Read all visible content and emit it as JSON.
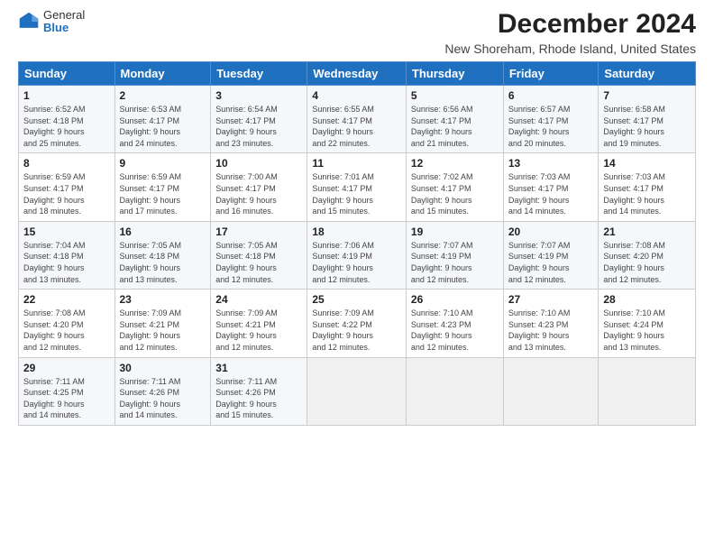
{
  "logo": {
    "general": "General",
    "blue": "Blue"
  },
  "title": "December 2024",
  "subtitle": "New Shoreham, Rhode Island, United States",
  "days_of_week": [
    "Sunday",
    "Monday",
    "Tuesday",
    "Wednesday",
    "Thursday",
    "Friday",
    "Saturday"
  ],
  "weeks": [
    [
      {
        "day": "1",
        "info": "Sunrise: 6:52 AM\nSunset: 4:18 PM\nDaylight: 9 hours\nand 25 minutes."
      },
      {
        "day": "2",
        "info": "Sunrise: 6:53 AM\nSunset: 4:17 PM\nDaylight: 9 hours\nand 24 minutes."
      },
      {
        "day": "3",
        "info": "Sunrise: 6:54 AM\nSunset: 4:17 PM\nDaylight: 9 hours\nand 23 minutes."
      },
      {
        "day": "4",
        "info": "Sunrise: 6:55 AM\nSunset: 4:17 PM\nDaylight: 9 hours\nand 22 minutes."
      },
      {
        "day": "5",
        "info": "Sunrise: 6:56 AM\nSunset: 4:17 PM\nDaylight: 9 hours\nand 21 minutes."
      },
      {
        "day": "6",
        "info": "Sunrise: 6:57 AM\nSunset: 4:17 PM\nDaylight: 9 hours\nand 20 minutes."
      },
      {
        "day": "7",
        "info": "Sunrise: 6:58 AM\nSunset: 4:17 PM\nDaylight: 9 hours\nand 19 minutes."
      }
    ],
    [
      {
        "day": "8",
        "info": "Sunrise: 6:59 AM\nSunset: 4:17 PM\nDaylight: 9 hours\nand 18 minutes."
      },
      {
        "day": "9",
        "info": "Sunrise: 6:59 AM\nSunset: 4:17 PM\nDaylight: 9 hours\nand 17 minutes."
      },
      {
        "day": "10",
        "info": "Sunrise: 7:00 AM\nSunset: 4:17 PM\nDaylight: 9 hours\nand 16 minutes."
      },
      {
        "day": "11",
        "info": "Sunrise: 7:01 AM\nSunset: 4:17 PM\nDaylight: 9 hours\nand 15 minutes."
      },
      {
        "day": "12",
        "info": "Sunrise: 7:02 AM\nSunset: 4:17 PM\nDaylight: 9 hours\nand 15 minutes."
      },
      {
        "day": "13",
        "info": "Sunrise: 7:03 AM\nSunset: 4:17 PM\nDaylight: 9 hours\nand 14 minutes."
      },
      {
        "day": "14",
        "info": "Sunrise: 7:03 AM\nSunset: 4:17 PM\nDaylight: 9 hours\nand 14 minutes."
      }
    ],
    [
      {
        "day": "15",
        "info": "Sunrise: 7:04 AM\nSunset: 4:18 PM\nDaylight: 9 hours\nand 13 minutes."
      },
      {
        "day": "16",
        "info": "Sunrise: 7:05 AM\nSunset: 4:18 PM\nDaylight: 9 hours\nand 13 minutes."
      },
      {
        "day": "17",
        "info": "Sunrise: 7:05 AM\nSunset: 4:18 PM\nDaylight: 9 hours\nand 12 minutes."
      },
      {
        "day": "18",
        "info": "Sunrise: 7:06 AM\nSunset: 4:19 PM\nDaylight: 9 hours\nand 12 minutes."
      },
      {
        "day": "19",
        "info": "Sunrise: 7:07 AM\nSunset: 4:19 PM\nDaylight: 9 hours\nand 12 minutes."
      },
      {
        "day": "20",
        "info": "Sunrise: 7:07 AM\nSunset: 4:19 PM\nDaylight: 9 hours\nand 12 minutes."
      },
      {
        "day": "21",
        "info": "Sunrise: 7:08 AM\nSunset: 4:20 PM\nDaylight: 9 hours\nand 12 minutes."
      }
    ],
    [
      {
        "day": "22",
        "info": "Sunrise: 7:08 AM\nSunset: 4:20 PM\nDaylight: 9 hours\nand 12 minutes."
      },
      {
        "day": "23",
        "info": "Sunrise: 7:09 AM\nSunset: 4:21 PM\nDaylight: 9 hours\nand 12 minutes."
      },
      {
        "day": "24",
        "info": "Sunrise: 7:09 AM\nSunset: 4:21 PM\nDaylight: 9 hours\nand 12 minutes."
      },
      {
        "day": "25",
        "info": "Sunrise: 7:09 AM\nSunset: 4:22 PM\nDaylight: 9 hours\nand 12 minutes."
      },
      {
        "day": "26",
        "info": "Sunrise: 7:10 AM\nSunset: 4:23 PM\nDaylight: 9 hours\nand 12 minutes."
      },
      {
        "day": "27",
        "info": "Sunrise: 7:10 AM\nSunset: 4:23 PM\nDaylight: 9 hours\nand 13 minutes."
      },
      {
        "day": "28",
        "info": "Sunrise: 7:10 AM\nSunset: 4:24 PM\nDaylight: 9 hours\nand 13 minutes."
      }
    ],
    [
      {
        "day": "29",
        "info": "Sunrise: 7:11 AM\nSunset: 4:25 PM\nDaylight: 9 hours\nand 14 minutes."
      },
      {
        "day": "30",
        "info": "Sunrise: 7:11 AM\nSunset: 4:26 PM\nDaylight: 9 hours\nand 14 minutes."
      },
      {
        "day": "31",
        "info": "Sunrise: 7:11 AM\nSunset: 4:26 PM\nDaylight: 9 hours\nand 15 minutes."
      },
      null,
      null,
      null,
      null
    ]
  ]
}
